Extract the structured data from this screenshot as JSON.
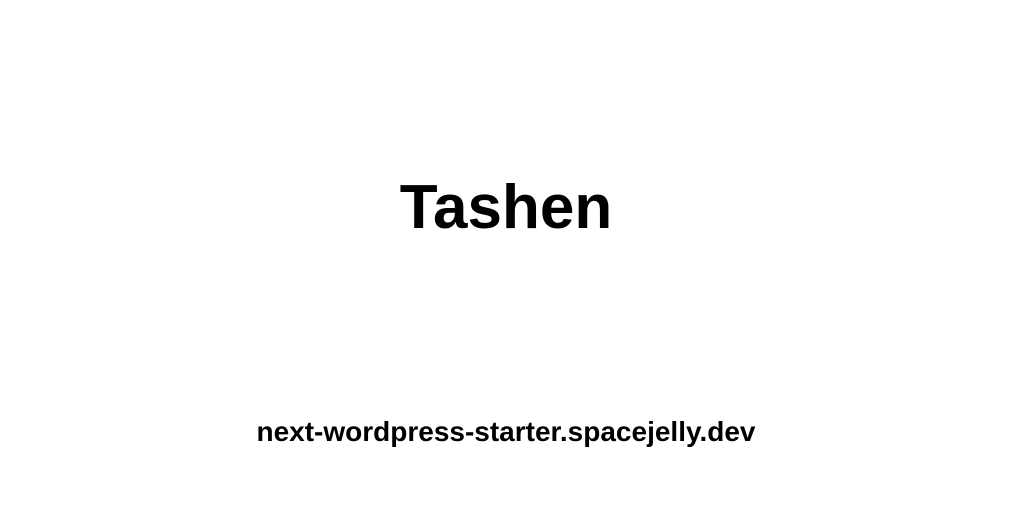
{
  "card": {
    "title": "Tashen",
    "domain": "next-wordpress-starter.spacejelly.dev"
  },
  "colors": {
    "background": "#ffffff",
    "text": "#000000"
  }
}
